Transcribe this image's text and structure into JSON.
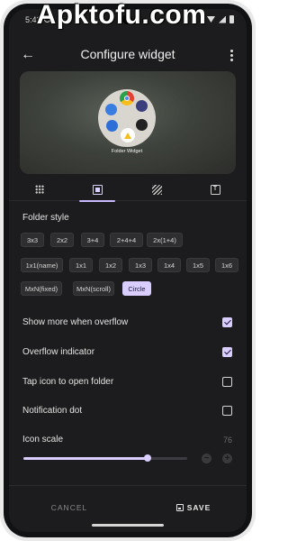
{
  "watermark": "Apktofu.com",
  "status_bar": {
    "time": "5:42"
  },
  "app_bar": {
    "title": "Configure widget"
  },
  "preview": {
    "folder_label": "Folder Widget",
    "apps": [
      {
        "icon": "chrome-icon",
        "glyph": "",
        "color": "#e34133"
      },
      {
        "icon": "apps-grid-icon",
        "glyph": "⠿",
        "color": "#3b3f7c"
      },
      {
        "icon": "files-icon",
        "glyph": "▭",
        "color": "#3a7de0"
      },
      {
        "icon": "settings-icon",
        "glyph": "⚙",
        "color": "#2d6fd6"
      },
      {
        "icon": "drive-icon",
        "glyph": "▲",
        "color": "#ffffff"
      },
      {
        "icon": "photos-icon",
        "glyph": "▴",
        "color": "#222222"
      }
    ]
  },
  "tabs": [
    {
      "name": "tab-grid",
      "icon": "grid-icon",
      "active": false
    },
    {
      "name": "tab-layout",
      "icon": "square-icon",
      "active": true
    },
    {
      "name": "tab-background",
      "icon": "hatch-icon",
      "active": false
    },
    {
      "name": "tab-text",
      "icon": "text-icon",
      "active": false
    }
  ],
  "folder_style": {
    "label": "Folder style",
    "text_icon_glyph": "T",
    "options": [
      "3x3",
      "2x2",
      "3+4",
      "2+4+4",
      "2x(1+4)",
      "1x1(name)",
      "1x1",
      "1x2",
      "1x3",
      "1x4",
      "1x5",
      "1x6",
      "MxN(fixed)",
      "MxN(scroll)",
      "Circle"
    ],
    "selected": "Circle"
  },
  "settings": [
    {
      "label": "Show more when overflow",
      "checked": true
    },
    {
      "label": "Overflow indicator",
      "checked": true
    },
    {
      "label": "Tap icon to open folder",
      "checked": false
    },
    {
      "label": "Notification dot",
      "checked": false
    }
  ],
  "icon_scale": {
    "label": "Icon scale",
    "value": "76",
    "fraction": 0.76,
    "minus": "−",
    "plus": "+"
  },
  "footer": {
    "cancel": "CANCEL",
    "save": "SAVE"
  }
}
